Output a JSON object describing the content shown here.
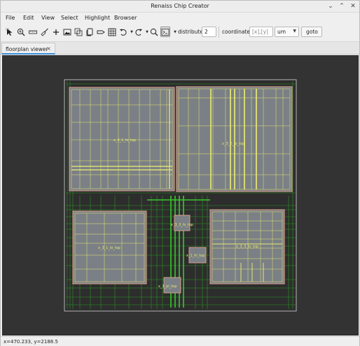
{
  "window": {
    "title": "Renaiss Chip Creator",
    "controls": [
      "⌄",
      "⌃",
      "✕"
    ]
  },
  "menu": {
    "items": [
      "File",
      "Edit",
      "View",
      "Select",
      "Highlight",
      "Browser"
    ]
  },
  "toolbar": {
    "icons": [
      "select-arrow-icon",
      "zoom-region-icon",
      "ruler-icon",
      "broom-icon",
      "crosshair-icon",
      "image-icon",
      "layers-icon",
      "copy-icon",
      "label-icon",
      "grid-icon",
      "undo-icon",
      "redo-icon",
      "search-icon",
      "terminal-icon"
    ],
    "distribute_label": "distribute:",
    "distribute_value": "2",
    "coordinate_label": "coordinate:",
    "coordinate_placeholder": "[x],[y]",
    "unit_value": "um",
    "goto_label": "goto"
  },
  "tabs": [
    {
      "label": "floorplan viewer",
      "close": "×"
    }
  ],
  "floorplan": {
    "instance_labels": [
      "x_3_1_hi_top",
      "x_3_2_hi_top",
      "x_3_3_hi_top",
      "x_3_1_lo_top",
      "x_1_hi_top",
      "x_3_3_lo_top",
      "x_1_pi_top"
    ],
    "colors": {
      "background": "#333333",
      "macro_fill": "#7a8085",
      "macro_border": "#e5a48f",
      "routing": "#27c21c",
      "cell_outline": "#e8e873"
    }
  },
  "status": {
    "cursor_text": "x=470.233, y=2188.5"
  }
}
